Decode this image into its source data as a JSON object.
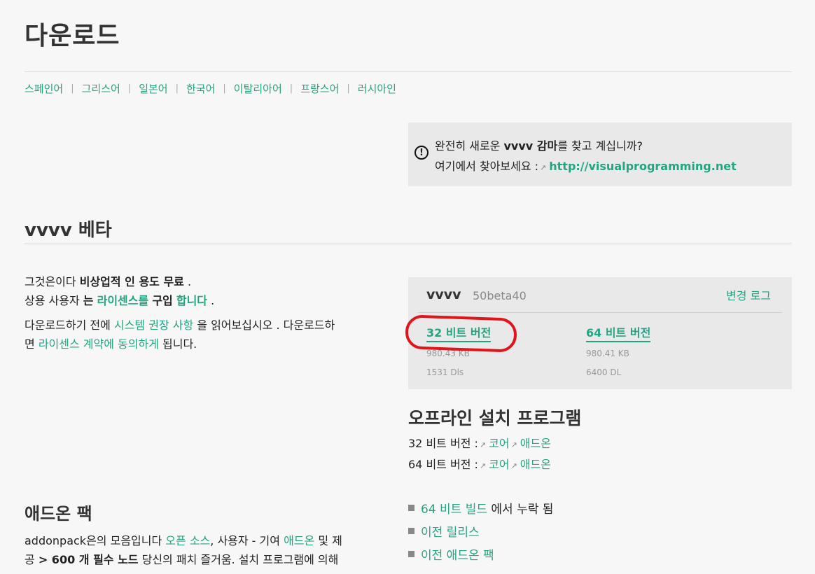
{
  "page": {
    "title": "다운로드"
  },
  "languages": [
    "스페인어",
    "그리스어",
    "일본어",
    "한국어",
    "이탈리아어",
    "프랑스어",
    "러시아인"
  ],
  "notice": {
    "icon": "exclamation-circle-icon",
    "line1_a": "완전히 새로운",
    "line1_b": "vvvv 감마",
    "line1_c": "를 찾고 계십니까?",
    "line2_a": "여기에서 찾아보세요 :",
    "line2_link": "http://visualprogramming.net"
  },
  "beta": {
    "heading": "vvvv 베타",
    "p1_a": "그것은이다",
    "p1_b": "비상업적 인 용도 무료",
    "p1_c": ".",
    "p2_a": "상용 사용자",
    "p2_b": "는",
    "p2_link1": "라이센스를",
    "p2_c": "구입",
    "p2_link2": "합니다",
    "p2_d": ".",
    "p3_a": "다운로드하기 전에",
    "p3_link1": "시스템 권장 사항",
    "p3_b": "을 읽어보십시오 . 다운로드하",
    "p3_c": "면",
    "p3_link2": "라이센스 계약에 동의하게",
    "p3_d": "됩니다."
  },
  "download_box": {
    "name": "vvvv",
    "version": "50beta40",
    "changelog": "변경 로그",
    "items": [
      {
        "label": "32 비트 버전",
        "size": "980.43 KB",
        "downloads": "1531 Dls"
      },
      {
        "label": "64 비트 버전",
        "size": "980.41 KB",
        "downloads": "6400 DL"
      }
    ]
  },
  "offline": {
    "heading": "오프라인 설치 프로그램",
    "rows": [
      {
        "label": "32 비트 버전 :",
        "core": "코어",
        "addon": "애드온"
      },
      {
        "label": "64 비트 버전 :",
        "core": "코어",
        "addon": "애드온"
      }
    ]
  },
  "links": {
    "item1_link": "64 비트 빌드",
    "item1_text": "에서 누락 됨",
    "item2": "이전 릴리스",
    "item3": "이전 애드온 팩"
  },
  "addonpack": {
    "heading": "애드온 팩",
    "a": "addonpack은의 모음입니다",
    "link1": "오픈 소스",
    "b": ", 사용자 - 기여",
    "link2": "애드온",
    "c": "및 제",
    "d": "공",
    "e": "> 600 개 필수 노드",
    "f": "당신의 패치 즐거움. 설치 프로그램에 의해"
  },
  "colors": {
    "accent": "#23a482",
    "annotation": "#e0141b",
    "panel": "#e9e9e9"
  }
}
